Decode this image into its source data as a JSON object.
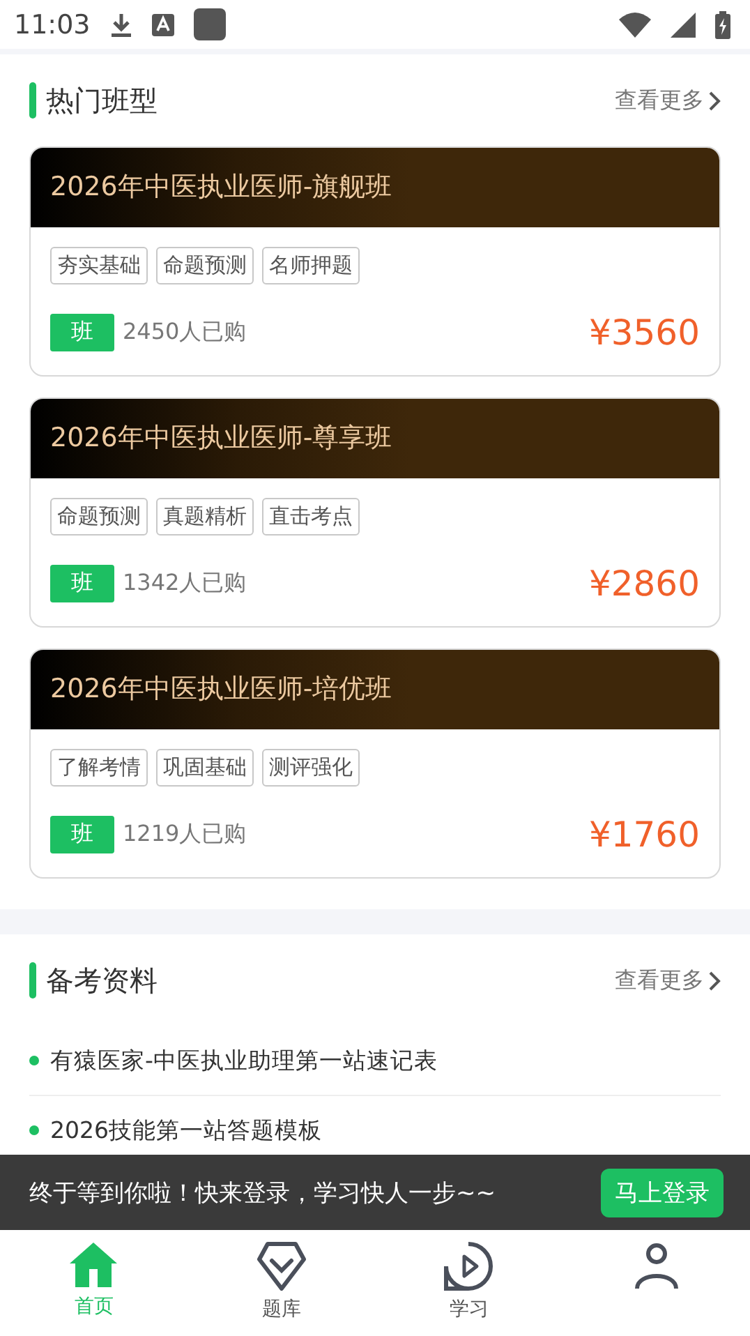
{
  "status_bar": {
    "time": "11:03"
  },
  "hot_classes": {
    "title": "热门班型",
    "more": "查看更多",
    "cards": [
      {
        "title": "2026年中医执业医师-旗舰班",
        "tags": [
          "夯实基础",
          "命题预测",
          "名师押题"
        ],
        "badge": "班",
        "buyers": "2450人已购",
        "price": "¥3560"
      },
      {
        "title": "2026年中医执业医师-尊享班",
        "tags": [
          "命题预测",
          "真题精析",
          "直击考点"
        ],
        "badge": "班",
        "buyers": "1342人已购",
        "price": "¥2860"
      },
      {
        "title": "2026年中医执业医师-培优班",
        "tags": [
          "了解考情",
          "巩固基础",
          "测评强化"
        ],
        "badge": "班",
        "buyers": "1219人已购",
        "price": "¥1760"
      }
    ]
  },
  "materials": {
    "title": "备考资料",
    "more": "查看更多",
    "items": [
      "有猿医家-中医执业助理第一站速记表",
      "2026技能第一站答题模板"
    ]
  },
  "login_banner": {
    "message": "终于等到你啦！快来登录，学习快人一步~~",
    "button": "马上登录"
  },
  "bottom_nav": [
    {
      "kind": "home",
      "label": "首页",
      "selected": true
    },
    {
      "kind": "quiz",
      "label": "题库",
      "selected": false
    },
    {
      "kind": "study",
      "label": "学习",
      "selected": false
    },
    {
      "kind": "profile",
      "selected": false
    }
  ]
}
